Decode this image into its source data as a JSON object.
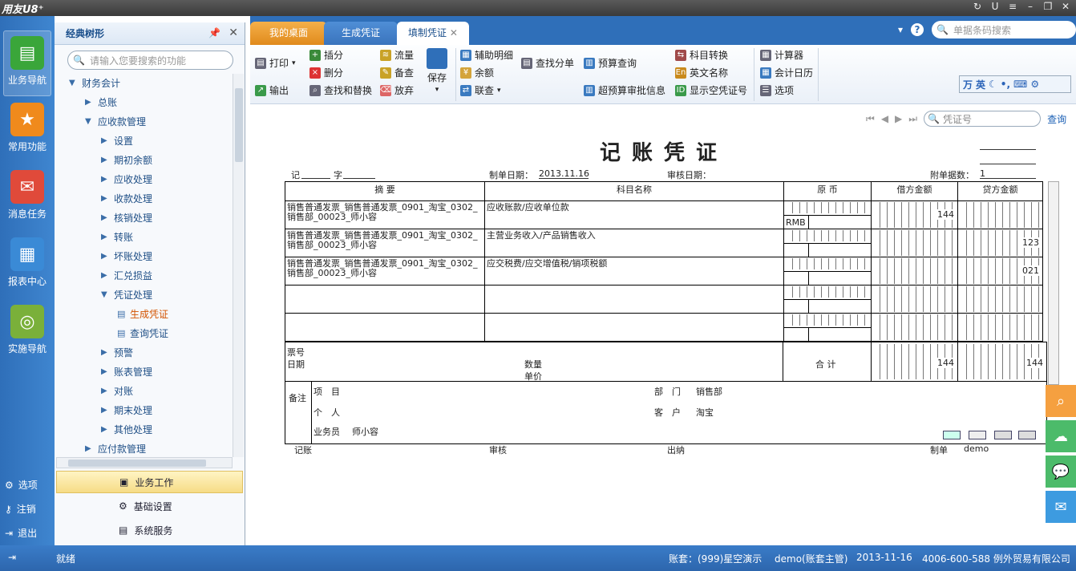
{
  "app": {
    "brand": "用友U8⁺"
  },
  "left_nav": [
    {
      "label": "业务导航",
      "icon": "business-nav-icon",
      "color": "#3aa63a"
    },
    {
      "label": "常用功能",
      "icon": "star-icon",
      "color": "#f08a1c"
    },
    {
      "label": "消息任务",
      "icon": "mail-icon",
      "color": "#e04a3a"
    },
    {
      "label": "报表中心",
      "icon": "report-icon",
      "color": "#3a8ad6"
    },
    {
      "label": "实施导航",
      "icon": "compass-icon",
      "color": "#7ab03a"
    }
  ],
  "left_bottom": [
    {
      "label": "选项"
    },
    {
      "label": "注销"
    },
    {
      "label": "退出"
    }
  ],
  "panel": {
    "title": "经典树形",
    "search_placeholder": "请输入您要搜索的功能",
    "tree": [
      {
        "label": "财务会计",
        "level": 0,
        "expanded": true
      },
      {
        "label": "总账",
        "level": 1
      },
      {
        "label": "应收款管理",
        "level": 1,
        "expanded": true
      },
      {
        "label": "设置",
        "level": 2
      },
      {
        "label": "期初余额",
        "level": 2
      },
      {
        "label": "应收处理",
        "level": 2
      },
      {
        "label": "收款处理",
        "level": 2
      },
      {
        "label": "核销处理",
        "level": 2
      },
      {
        "label": "转账",
        "level": 2
      },
      {
        "label": "坏账处理",
        "level": 2
      },
      {
        "label": "汇兑损益",
        "level": 2
      },
      {
        "label": "凭证处理",
        "level": 2,
        "expanded": true
      },
      {
        "label": "生成凭证",
        "level": 3,
        "selected": true
      },
      {
        "label": "查询凭证",
        "level": 3
      },
      {
        "label": "预警",
        "level": 2
      },
      {
        "label": "账表管理",
        "level": 2
      },
      {
        "label": "对账",
        "level": 2
      },
      {
        "label": "期末处理",
        "level": 2
      },
      {
        "label": "其他处理",
        "level": 2
      },
      {
        "label": "应付款管理",
        "level": 1
      }
    ],
    "bottom_buttons": [
      {
        "label": "业务工作",
        "active": true
      },
      {
        "label": "基础设置"
      },
      {
        "label": "系统服务"
      }
    ]
  },
  "tabs": [
    {
      "label": "我的桌面"
    },
    {
      "label": "生成凭证"
    },
    {
      "label": "填制凭证"
    }
  ],
  "barcode_search_placeholder": "单据条码搜索",
  "toolbar": {
    "print": "打印",
    "export": "输出",
    "insert": "插分",
    "delete": "删分",
    "find_replace": "查找和替换",
    "flow": "流量",
    "memo": "备查",
    "discard": "放弃",
    "save": "保存",
    "aux_detail": "辅助明细",
    "balance": "余额",
    "link": "联查",
    "find_entry": "查找分单",
    "budget_query": "预算查询",
    "over_budget": "超预算审批信息",
    "subject_convert": "科目转换",
    "english_name": "英文名称",
    "show_empty_no": "显示空凭证号",
    "calculator": "计算器",
    "calendar": "会计日历",
    "options": "选项"
  },
  "ime": {
    "label": "英"
  },
  "voucher": {
    "no_placeholder": "凭证号",
    "query": "查询",
    "title": "记账凭证",
    "word_label": "记",
    "zi_label": "字",
    "date_label": "制单日期：",
    "date": "2013.11.16",
    "audit_date_label": "审核日期：",
    "attach_label": "附单据数：",
    "attach_count": "1",
    "headers": {
      "summary": "摘 要",
      "account": "科目名称",
      "orig_currency": "原 币",
      "debit": "借方金额",
      "credit": "贷方金额"
    },
    "rows": [
      {
        "summary": "销售普通发票_销售普通发票_0901_淘宝_0302_销售部_00023_师小容",
        "account": "应收账款/应收单位款",
        "currency": "RMB",
        "debit": "144",
        "credit": ""
      },
      {
        "summary": "销售普通发票_销售普通发票_0901_淘宝_0302_销售部_00023_师小容",
        "account": "主营业务收入/产品销售收入",
        "currency": "",
        "debit": "",
        "credit": "123"
      },
      {
        "summary": "销售普通发票_销售普通发票_0901_淘宝_0302_销售部_00023_师小容",
        "account": "应交税费/应交增值税/销项税额",
        "currency": "",
        "debit": "",
        "credit": "021"
      },
      {
        "summary": "",
        "account": "",
        "currency": "",
        "debit": "",
        "credit": ""
      },
      {
        "summary": "",
        "account": "",
        "currency": "",
        "debit": "",
        "credit": ""
      }
    ],
    "ticket_no": "票号",
    "ticket_date": "日期",
    "quantity": "数量",
    "unit_price": "单价",
    "total_label": "合 计",
    "total_debit": "144",
    "total_credit": "144",
    "remark_label": "备注",
    "project_label": "项　目",
    "dept_label": "部　门",
    "dept_value": "销售部",
    "person_label": "个　人",
    "customer_label": "客　户",
    "customer_value": "淘宝",
    "salesman_label": "业务员",
    "salesman_value": "师小容",
    "footer": {
      "bookkeep": "记账",
      "audit": "审核",
      "cashier": "出纳",
      "maker_label": "制单",
      "maker": "demo"
    }
  },
  "status": {
    "ready": "就绪",
    "account": "账套：(999)星空演示",
    "user": "demo(账套主管)",
    "date": "2013-11-16",
    "company": "4006-600-588 例外贸易有限公司"
  },
  "colors": {
    "nav_blue": "#2f6fb9",
    "tab_orange": "#f5b04a",
    "selected_tree": "#d35400",
    "side_orange": "#f5a040",
    "side_green": "#4cbb6a",
    "side_blue": "#3d9be0"
  }
}
